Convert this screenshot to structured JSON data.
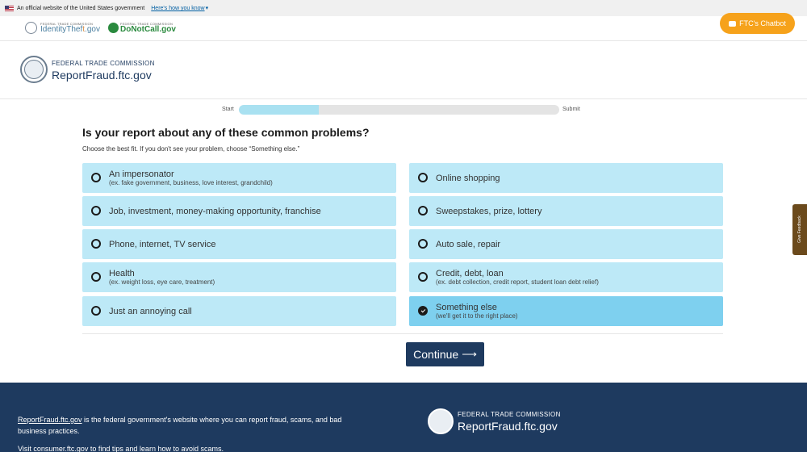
{
  "gov_banner": {
    "text": "An official website of the United States government",
    "link": "Here's how you know"
  },
  "top_links": {
    "identitytheft_small": "FEDERAL TRADE COMMISSION",
    "identitytheft_name_a": "IdentityThef",
    "identitytheft_name_b": "t",
    "identitytheft_name_c": ".gov",
    "donotcall_small": "FEDERAL TRADE COMMISSION",
    "donotcall_name": "DoNotCall.gov"
  },
  "chatbot": {
    "label": "FTC's Chatbot"
  },
  "header": {
    "agency": "FEDERAL TRADE COMMISSION",
    "site": "ReportFraud.ftc.gov"
  },
  "progress": {
    "start_label": "Start",
    "end_label": "Submit",
    "fraction": 0.25
  },
  "question": {
    "title": "Is your report about any of these common problems?",
    "hint": "Choose the best fit. If you don't see your problem, choose “Something else.”"
  },
  "options": [
    {
      "label": "An impersonator",
      "sub": "(ex. fake government, business, love interest, grandchild)",
      "selected": false
    },
    {
      "label": "Online shopping",
      "sub": "",
      "selected": false
    },
    {
      "label": "Job, investment, money-making opportunity, franchise",
      "sub": "",
      "selected": false
    },
    {
      "label": "Sweepstakes, prize, lottery",
      "sub": "",
      "selected": false
    },
    {
      "label": "Phone, internet, TV service",
      "sub": "",
      "selected": false
    },
    {
      "label": "Auto sale, repair",
      "sub": "",
      "selected": false
    },
    {
      "label": "Health",
      "sub": "(ex. weight loss, eye care, treatment)",
      "selected": false
    },
    {
      "label": "Credit, debt, loan",
      "sub": "(ex. debt collection, credit report, student loan debt relief)",
      "selected": false
    },
    {
      "label": "Just an annoying call",
      "sub": "",
      "selected": false
    },
    {
      "label": "Something else",
      "sub": "(we'll get it to the right place)",
      "selected": true
    }
  ],
  "continue_button": {
    "label": "Continue"
  },
  "feedback_tab": {
    "label": "Give Feedback"
  },
  "footer": {
    "link1": "ReportFraud.ftc.gov",
    "text1": " is the federal government's website where you can report fraud, scams, and bad business practices.",
    "text2a": "Visit ",
    "link2": "consumer.ftc.gov",
    "text2b": " to find tips and learn how to avoid scams.",
    "agency": "FEDERAL TRADE COMMISSION",
    "site": "ReportFraud.ftc.gov"
  }
}
